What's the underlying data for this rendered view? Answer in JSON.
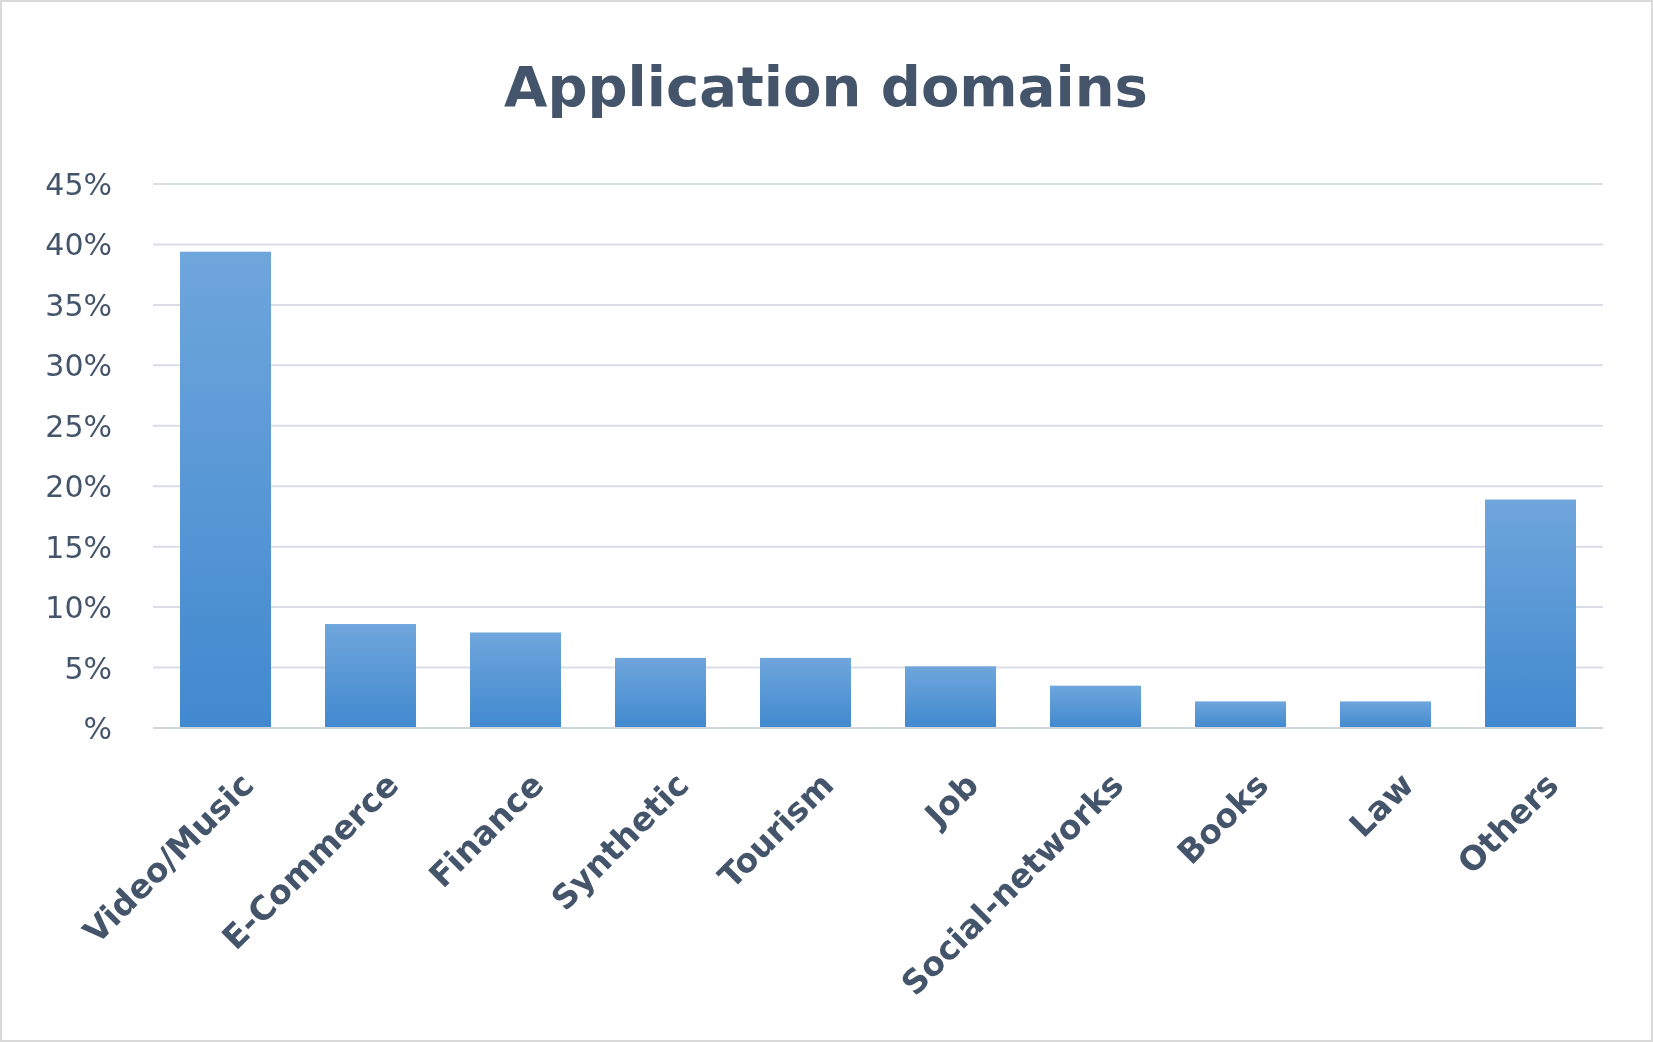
{
  "chart_data": {
    "type": "bar",
    "title": "Application domains",
    "categories": [
      "Video/Music",
      "E-Commerce",
      "Finance",
      "Synthetic",
      "Tourism",
      "Job",
      "Social-networks",
      "Books",
      "Law",
      "Others"
    ],
    "values": [
      39.4,
      8.6,
      7.9,
      5.8,
      5.8,
      5.1,
      3.5,
      2.2,
      2.2,
      18.9
    ],
    "grid": true,
    "ylim": [
      0,
      45
    ],
    "yticks": [
      {
        "value": 0,
        "label": "%"
      },
      {
        "value": 5,
        "label": "5%"
      },
      {
        "value": 10,
        "label": "10%"
      },
      {
        "value": 15,
        "label": "15%"
      },
      {
        "value": 20,
        "label": "20%"
      },
      {
        "value": 25,
        "label": "25%"
      },
      {
        "value": 30,
        "label": "30%"
      },
      {
        "value": 35,
        "label": "35%"
      },
      {
        "value": 40,
        "label": "40%"
      },
      {
        "value": 45,
        "label": "45%"
      }
    ]
  }
}
